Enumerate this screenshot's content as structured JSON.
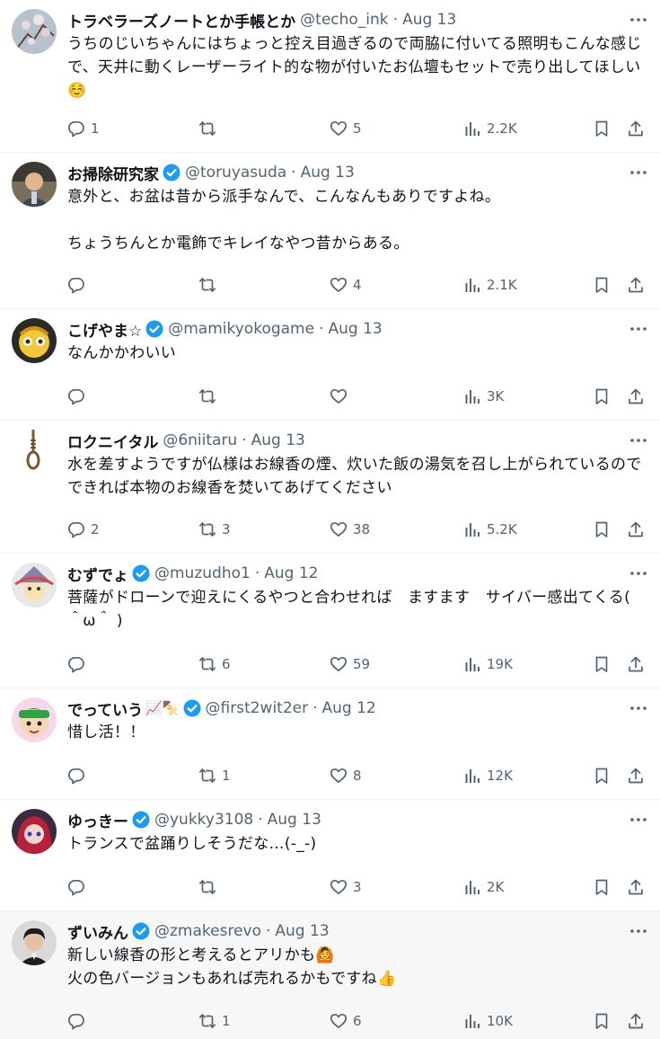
{
  "colors": {
    "accent": "#1d9bf0",
    "muted": "#536471",
    "text": "#0f1419",
    "border": "#eff3f4"
  },
  "icons": {
    "reply": "speech-bubble-icon",
    "retweet": "retweet-arrows-icon",
    "like": "heart-outline-icon",
    "views": "bar-chart-icon",
    "bookmark": "bookmark-icon",
    "share": "share-upload-icon",
    "more": "ellipsis-icon",
    "verified": "blue-check-badge-icon"
  },
  "tweets": [
    {
      "avatar": "cherry-blossom-branch-photo",
      "name": "トラベラーズノートとか手帳とか",
      "verified": false,
      "emoji": "",
      "handle": "@techo_ink",
      "dot": "·",
      "date": "Aug 13",
      "text": "うちのじいちゃんにはちょっと控え目過ぎるので両脇に付いてる照明もこんな感じで、天井に動くレーザーライト的な物が付いたお仏壇もセットで売り出してほしい☺️",
      "replies": "1",
      "retweets": "",
      "likes": "5",
      "views": "2.2K"
    },
    {
      "avatar": "man-in-suit-photo",
      "name": "お掃除研究家",
      "verified": true,
      "emoji": "",
      "handle": "@toruyasuda",
      "dot": "·",
      "date": "Aug 13",
      "text": "意外と、お盆は昔から派手なんで、こんなんもありですよね。\n\nちょうちんとか電飾でキレイなやつ昔からある。",
      "replies": "",
      "retweets": "",
      "likes": "4",
      "views": "2.1K"
    },
    {
      "avatar": "blonde-anime-character",
      "name": "こげやま☆",
      "verified": true,
      "emoji": "",
      "handle": "@mamikyokogame",
      "dot": "·",
      "date": "Aug 13",
      "text": "なんかかわいい",
      "replies": "",
      "retweets": "",
      "likes": "",
      "views": "3K"
    },
    {
      "avatar": "noose-rope-illustration",
      "name": "ロクニイタル",
      "verified": false,
      "emoji": "",
      "handle": "@6niitaru",
      "dot": "·",
      "date": "Aug 13",
      "text": "水を差すようですが仏様はお線香の煙、炊いた飯の湯気を召し上がられているのでできれば本物のお線香を焚いてあげてください",
      "replies": "2",
      "retweets": "3",
      "likes": "38",
      "views": "5.2K"
    },
    {
      "avatar": "jester-hat-character",
      "name": "むずでょ",
      "verified": true,
      "emoji": "",
      "handle": "@muzudho1",
      "dot": "·",
      "date": "Aug 12",
      "text": "菩薩がドローンで迎えにくるやつと合わせれば　ますます　サイバー感出てくる( ＾ω＾ )",
      "replies": "",
      "retweets": "6",
      "likes": "59",
      "views": "19K"
    },
    {
      "avatar": "green-hair-cartoon-face",
      "name": "でっていう",
      "verified": true,
      "emoji": "📈🍢",
      "handle": "@first2wit2er",
      "dot": "·",
      "date": "Aug 12",
      "text": "惜し活！！",
      "replies": "",
      "retweets": "1",
      "likes": "8",
      "views": "12K"
    },
    {
      "avatar": "red-hair-anime-girl",
      "name": "ゆっきー",
      "verified": true,
      "emoji": "",
      "handle": "@yukky3108",
      "dot": "·",
      "date": "Aug 13",
      "text": "トランスで盆踊りしそうだな…(-_-)",
      "replies": "",
      "retweets": "",
      "likes": "3",
      "views": "2K"
    },
    {
      "avatar": "dark-hair-man-photo",
      "name": "ずいみん",
      "verified": true,
      "emoji": "",
      "handle": "@zmakesrevo",
      "dot": "·",
      "date": "Aug 13",
      "text": "新しい線香の形と考えるとアリかも🙆\n火の色バージョンもあれば売れるかもですね👍",
      "replies": "",
      "retweets": "1",
      "likes": "6",
      "views": "10K"
    }
  ]
}
